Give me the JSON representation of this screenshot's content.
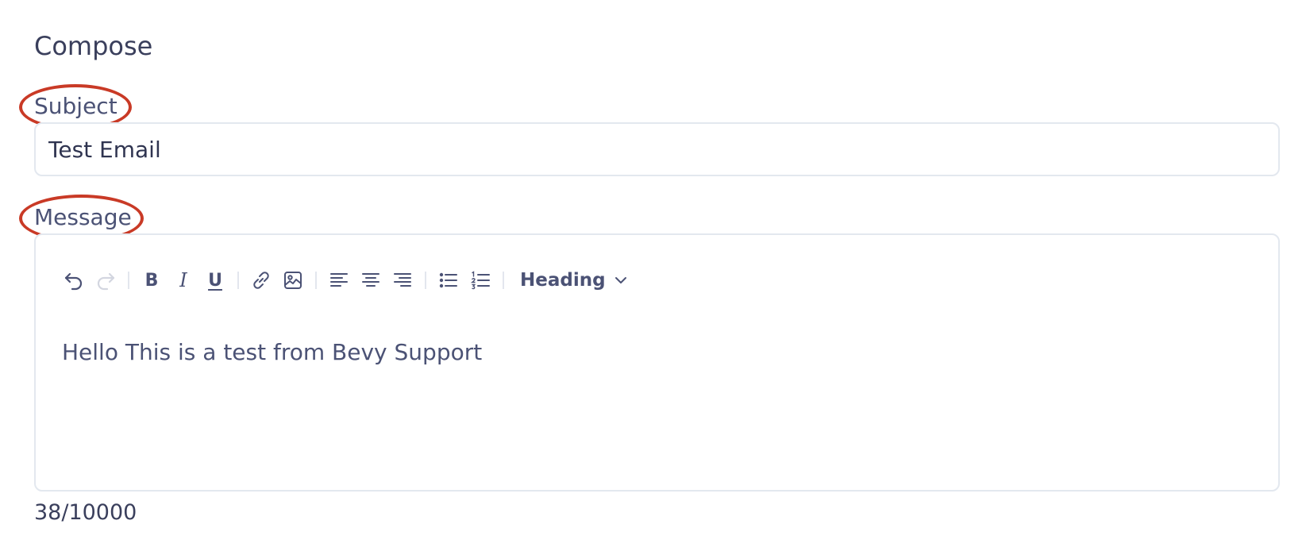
{
  "compose": {
    "title": "Compose",
    "subject_label": "Subject",
    "subject_value": "Test Email",
    "message_label": "Message",
    "message_body": "Hello This is a test from Bevy Support",
    "char_counter": "38/10000"
  },
  "toolbar": {
    "buttons": [
      {
        "icon": "undo-icon"
      },
      {
        "icon": "redo-icon",
        "disabled": true
      },
      {
        "icon": "bold-icon",
        "glyph": "B"
      },
      {
        "icon": "italic-icon",
        "glyph": "I"
      },
      {
        "icon": "underline-icon",
        "glyph": "U"
      },
      {
        "icon": "link-icon"
      },
      {
        "icon": "image-icon"
      },
      {
        "icon": "align-left-icon"
      },
      {
        "icon": "align-center-icon"
      },
      {
        "icon": "align-right-icon"
      },
      {
        "icon": "bullet-list-icon"
      },
      {
        "icon": "numbered-list-icon"
      }
    ],
    "heading_label": "Heading"
  },
  "colors": {
    "annotation": "#c93a26",
    "text": "#4b5275",
    "border": "#e3e8ef"
  }
}
